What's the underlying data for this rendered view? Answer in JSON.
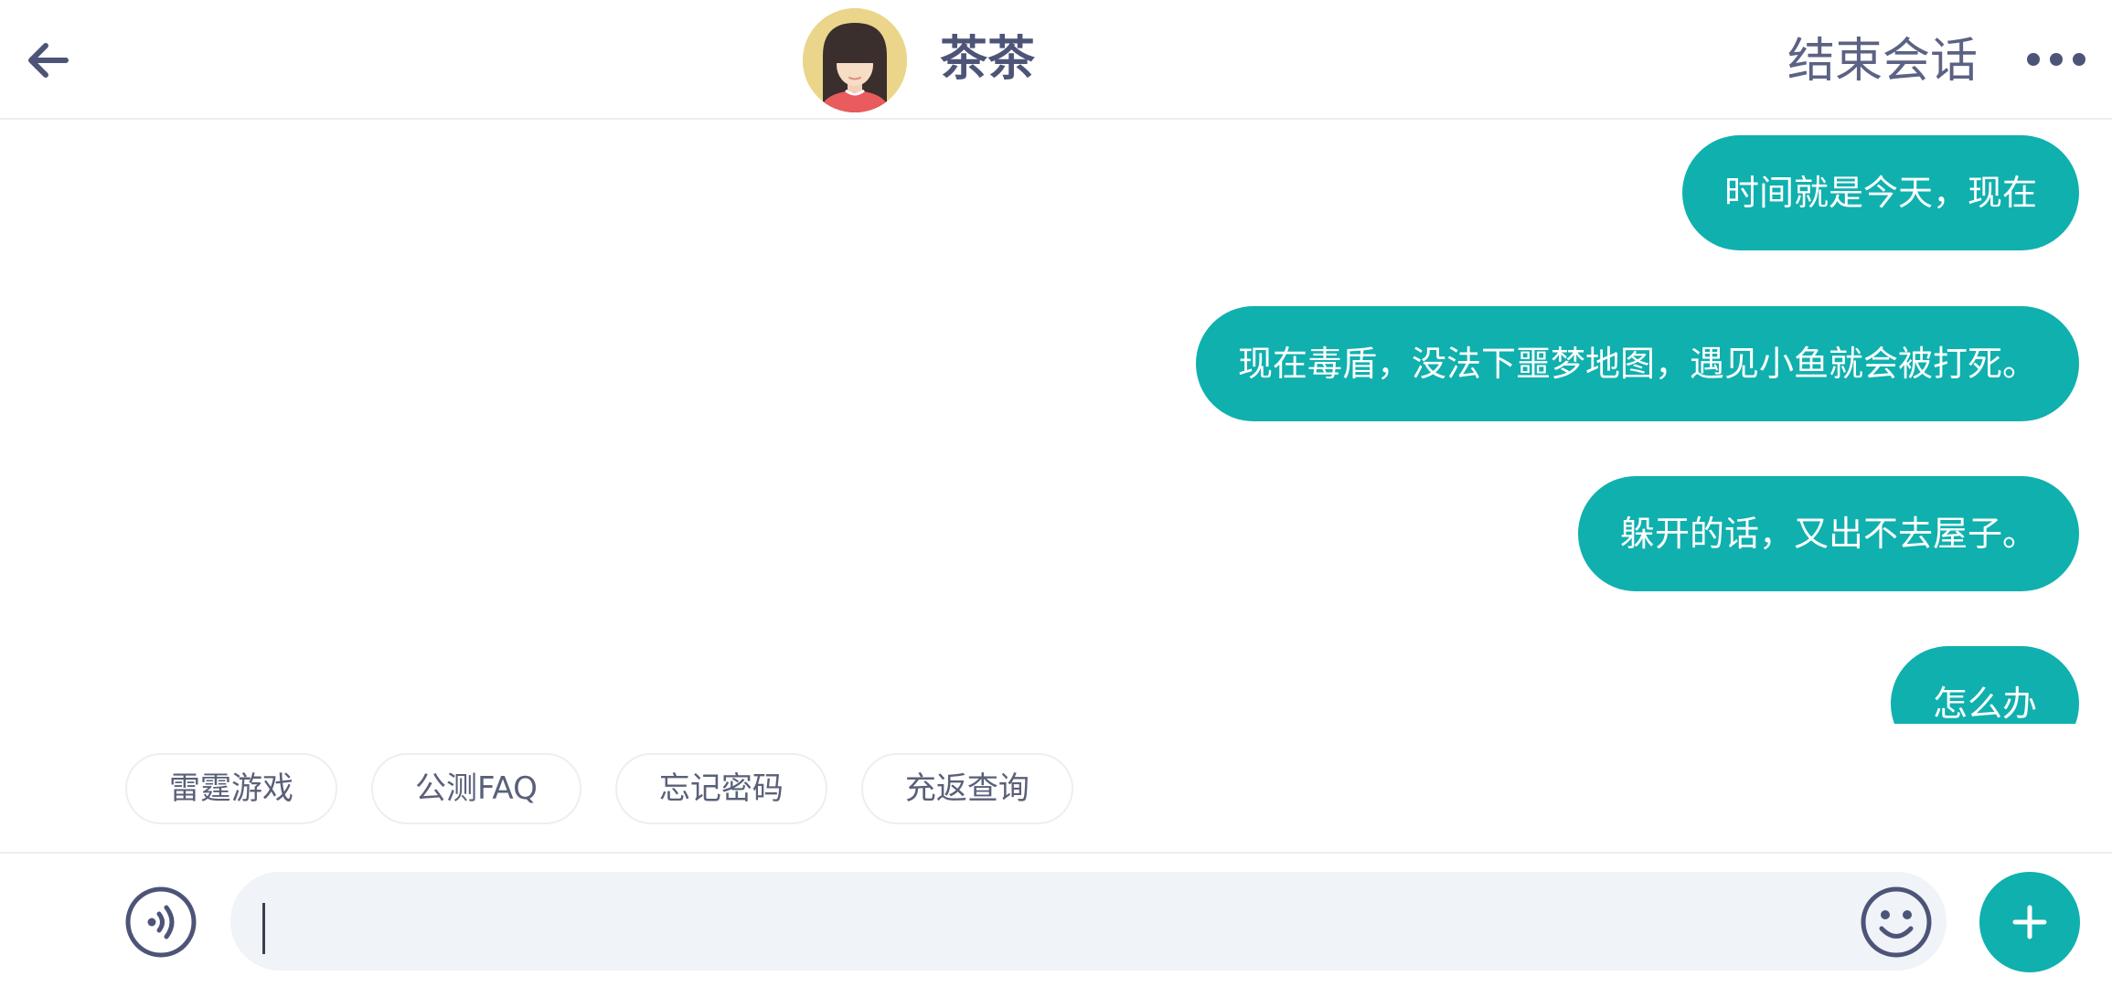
{
  "header": {
    "agent_name": "茶茶",
    "end_session_label": "结束会话",
    "icons": {
      "back": "back-arrow-icon",
      "more": "more-dots-icon"
    }
  },
  "messages": [
    {
      "text": "时间就是今天，现在",
      "sender": "user"
    },
    {
      "text": "现在毒盾，没法下噩梦地图，遇见小鱼就会被打死。",
      "sender": "user"
    },
    {
      "text": "躲开的话，又出不去屋子。",
      "sender": "user"
    },
    {
      "text": "怎么办",
      "sender": "user"
    }
  ],
  "quick_replies": [
    "雷霆游戏",
    "公测FAQ",
    "忘记密码",
    "充返查询"
  ],
  "input_bar": {
    "value": "",
    "icons": {
      "voice": "voice-icon",
      "emoji": "emoji-icon",
      "plus": "plus-icon"
    }
  },
  "colors": {
    "accent": "#10b0ae",
    "header_text": "#4d5478",
    "chip_text": "#5a6079",
    "input_bg": "#f0f3f7",
    "divider": "#eceef2"
  }
}
